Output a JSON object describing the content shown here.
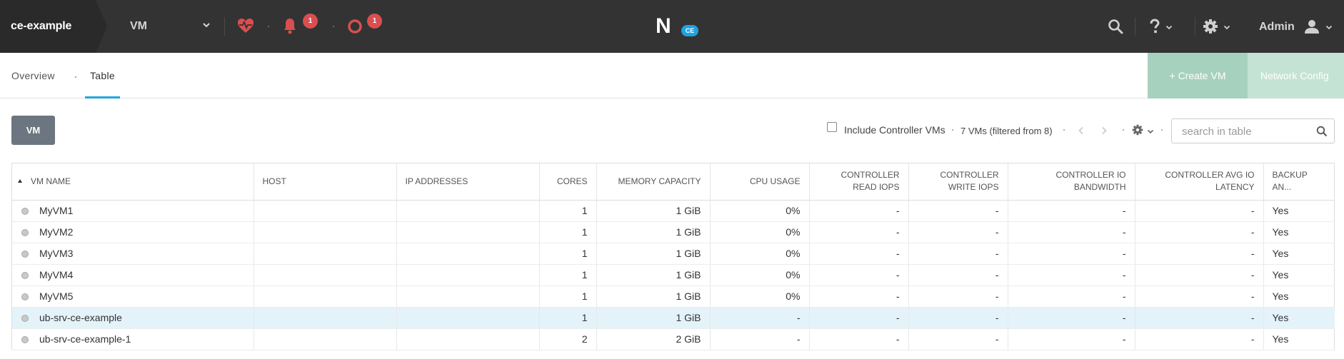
{
  "header": {
    "cluster_name": "ce-example",
    "entity": "VM",
    "alerts_count": "1",
    "tasks_count": "1",
    "logo_badge": "CE",
    "user": "Admin",
    "icons": [
      "health-heart-icon",
      "alert-bell-icon",
      "tasks-circle-icon",
      "search-icon",
      "help-icon",
      "gear-icon",
      "user-icon"
    ],
    "colors": {
      "bar": "#333333",
      "alert": "#d94f4f",
      "health": "#d94f4f",
      "logo_badge": "#1fa3e0"
    }
  },
  "subnav": {
    "tabs": [
      {
        "label": "Overview"
      },
      {
        "label": "Table"
      }
    ],
    "active_tab": "Table",
    "create_vm_label": "+ Create VM",
    "network_config_label": "Network Config"
  },
  "toolbar": {
    "vm_button": "VM",
    "include_controller_label": "Include Controller VMs",
    "include_controller_checked": false,
    "vm_count": "7 VMs (filtered from 8)",
    "search_placeholder": "search in table"
  },
  "table": {
    "columns": [
      "VM NAME",
      "HOST",
      "IP ADDRESSES",
      "CORES",
      "MEMORY CAPACITY",
      "CPU USAGE",
      "CONTROLLER READ IOPS",
      "CONTROLLER WRITE IOPS",
      "CONTROLLER IO BANDWIDTH",
      "CONTROLLER AVG IO LATENCY",
      "BACKUP AN..."
    ],
    "rows": [
      [
        "MyVM1",
        "",
        "",
        "1",
        "1 GiB",
        "0%",
        "-",
        "-",
        "-",
        "-",
        "Yes"
      ],
      [
        "MyVM2",
        "",
        "",
        "1",
        "1 GiB",
        "0%",
        "-",
        "-",
        "-",
        "-",
        "Yes"
      ],
      [
        "MyVM3",
        "",
        "",
        "1",
        "1 GiB",
        "0%",
        "-",
        "-",
        "-",
        "-",
        "Yes"
      ],
      [
        "MyVM4",
        "",
        "",
        "1",
        "1 GiB",
        "0%",
        "-",
        "-",
        "-",
        "-",
        "Yes"
      ],
      [
        "MyVM5",
        "",
        "",
        "1",
        "1 GiB",
        "0%",
        "-",
        "-",
        "-",
        "-",
        "Yes"
      ],
      [
        "ub-srv-ce-example",
        "",
        "",
        "1",
        "1 GiB",
        "-",
        "-",
        "-",
        "-",
        "-",
        "Yes"
      ],
      [
        "ub-srv-ce-example-1",
        "",
        "",
        "2",
        "2 GiB",
        "-",
        "-",
        "-",
        "-",
        "-",
        "Yes"
      ]
    ],
    "highlighted_row": "ub-srv-ce-example"
  }
}
